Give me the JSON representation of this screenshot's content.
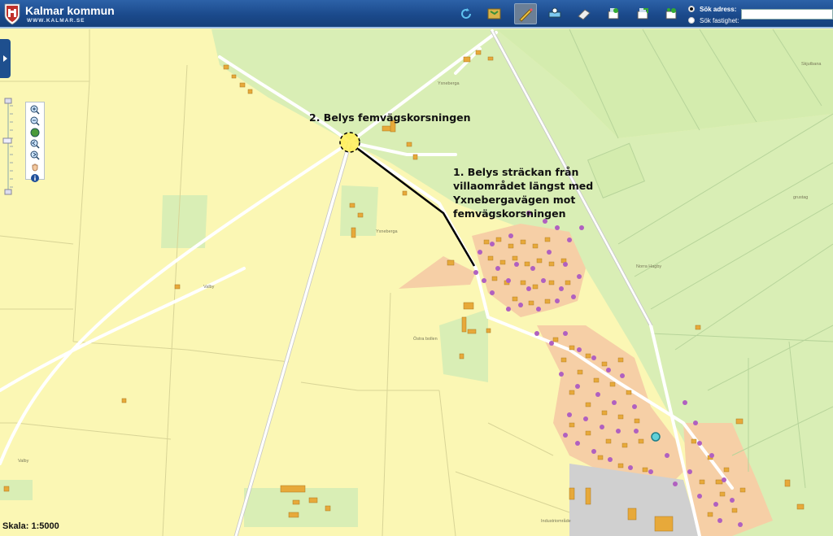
{
  "header": {
    "brand_title": "Kalmar kommun",
    "brand_subtitle": "WWW.KALMAR.SE",
    "tools": [
      {
        "name": "refresh-icon"
      },
      {
        "name": "map-layers-icon"
      },
      {
        "name": "draw-tool-icon",
        "active": true
      },
      {
        "name": "measure-icon"
      },
      {
        "name": "eraser-icon"
      },
      {
        "name": "print-icon"
      },
      {
        "name": "export-icon"
      },
      {
        "name": "share-icon"
      }
    ],
    "search": {
      "options": [
        {
          "label": "Sök adress:",
          "selected": true
        },
        {
          "label": "Sök fastighet:",
          "selected": false
        }
      ],
      "value": ""
    }
  },
  "map": {
    "scale_text": "Skala: 1:5000",
    "annotations": {
      "five_way_title": "2. Belys femvägskorsningen",
      "stretch_line1": "1. Belys sträckan från",
      "stretch_line2": "villaområdet längst med",
      "stretch_line3": "Yxnebergavägen mot",
      "stretch_line4": "femvägskorsningen"
    },
    "place_labels": {
      "yxneberga_n": "Yxneberga",
      "yxneberga": "Yxneberga",
      "valby": "Valby",
      "valby_sw": "Valby",
      "norra_hagby": "Norra Hagby",
      "ostra_bollen": "Östra bollen",
      "skjutbana": "Skjutbana",
      "grustag": "grustag",
      "industriomrade": "Industriområde"
    },
    "colors": {
      "farmland": "#fbf7b4",
      "green_area": "#d9eeb5",
      "residential": "#f6cfa6",
      "building": "#e7a93a",
      "street_light_marker": "#b060c0",
      "highlight_circle": "#ffee55"
    }
  }
}
